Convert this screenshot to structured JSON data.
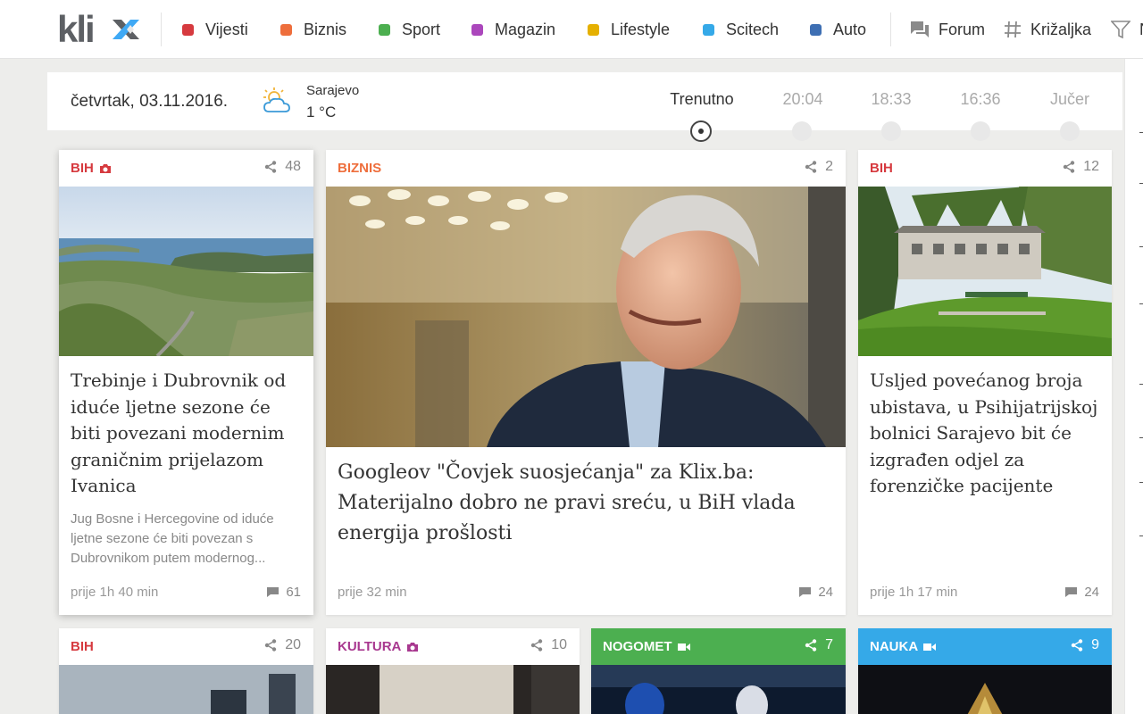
{
  "nav": {
    "logo_text": "klix",
    "items": [
      {
        "label": "Vijesti",
        "color": "#d63a3f"
      },
      {
        "label": "Biznis",
        "color": "#ee6e3c"
      },
      {
        "label": "Sport",
        "color": "#4caf50"
      },
      {
        "label": "Magazin",
        "color": "#ab47bc"
      },
      {
        "label": "Lifestyle",
        "color": "#e5b000"
      },
      {
        "label": "Scitech",
        "color": "#35a9e8"
      },
      {
        "label": "Auto",
        "color": "#3e6fb3"
      }
    ],
    "forum_label": "Forum",
    "krizaljka_label": "Križaljka",
    "filter_label": "N",
    "icons": [
      "chat-icon",
      "hash-icon",
      "filter-icon"
    ]
  },
  "datebar": {
    "date": "četvrtak, 03.11.2016.",
    "weather": {
      "city": "Sarajevo",
      "temp": "1 °C",
      "icon": "partly-cloudy-icon"
    },
    "timeline": [
      "Trenutno",
      "20:04",
      "18:33",
      "16:36",
      "Jučer"
    ],
    "timeline_active": "Trenutno"
  },
  "cards": [
    {
      "category": "BIH",
      "category_color": "#d63a3f",
      "category_icon": "camera-icon",
      "shares": "48",
      "title": "Trebinje i Dubrovnik od iduće ljetne sezone će biti povezani modernim graničnim prijelazom Ivanica",
      "lead": "Jug Bosne i Hercegovine od iduće ljetne sezone će biti povezan s Dubrovnikom putem modernog...",
      "time": "prije 1h 40 min",
      "comments": "61"
    },
    {
      "category": "BIZNIS",
      "category_color": "#ee6e3c",
      "shares": "2",
      "title": "Googleov \"Čovjek suosjećanja\" za Klix.ba: Materijalno dobro ne pravi sreću, u BiH vlada energija prošlosti",
      "time": "prije 32 min",
      "comments": "24"
    },
    {
      "category": "BIH",
      "category_color": "#d63a3f",
      "shares": "12",
      "title": "Usljed povećanog broja ubistava, u Psihijatrijskoj bolnici Sarajevo bit će izgrađen odjel za forenzičke pacijente",
      "time": "prije 1h 17 min",
      "comments": "24"
    },
    {
      "category": "BIH",
      "category_color": "#d63a3f",
      "shares": "20"
    },
    {
      "category": "KULTURA",
      "category_color": "#a8388f",
      "category_icon": "camera-icon",
      "shares": "10"
    },
    {
      "category": "NOGOMET",
      "category_color": "#4caf50",
      "category_icon": "video-icon",
      "shares": "7",
      "header_bg": "#4caf50"
    },
    {
      "category": "NAUKA",
      "category_color": "#35a9e8",
      "category_icon": "video-icon",
      "shares": "9",
      "header_bg": "#35a9e8"
    }
  ]
}
